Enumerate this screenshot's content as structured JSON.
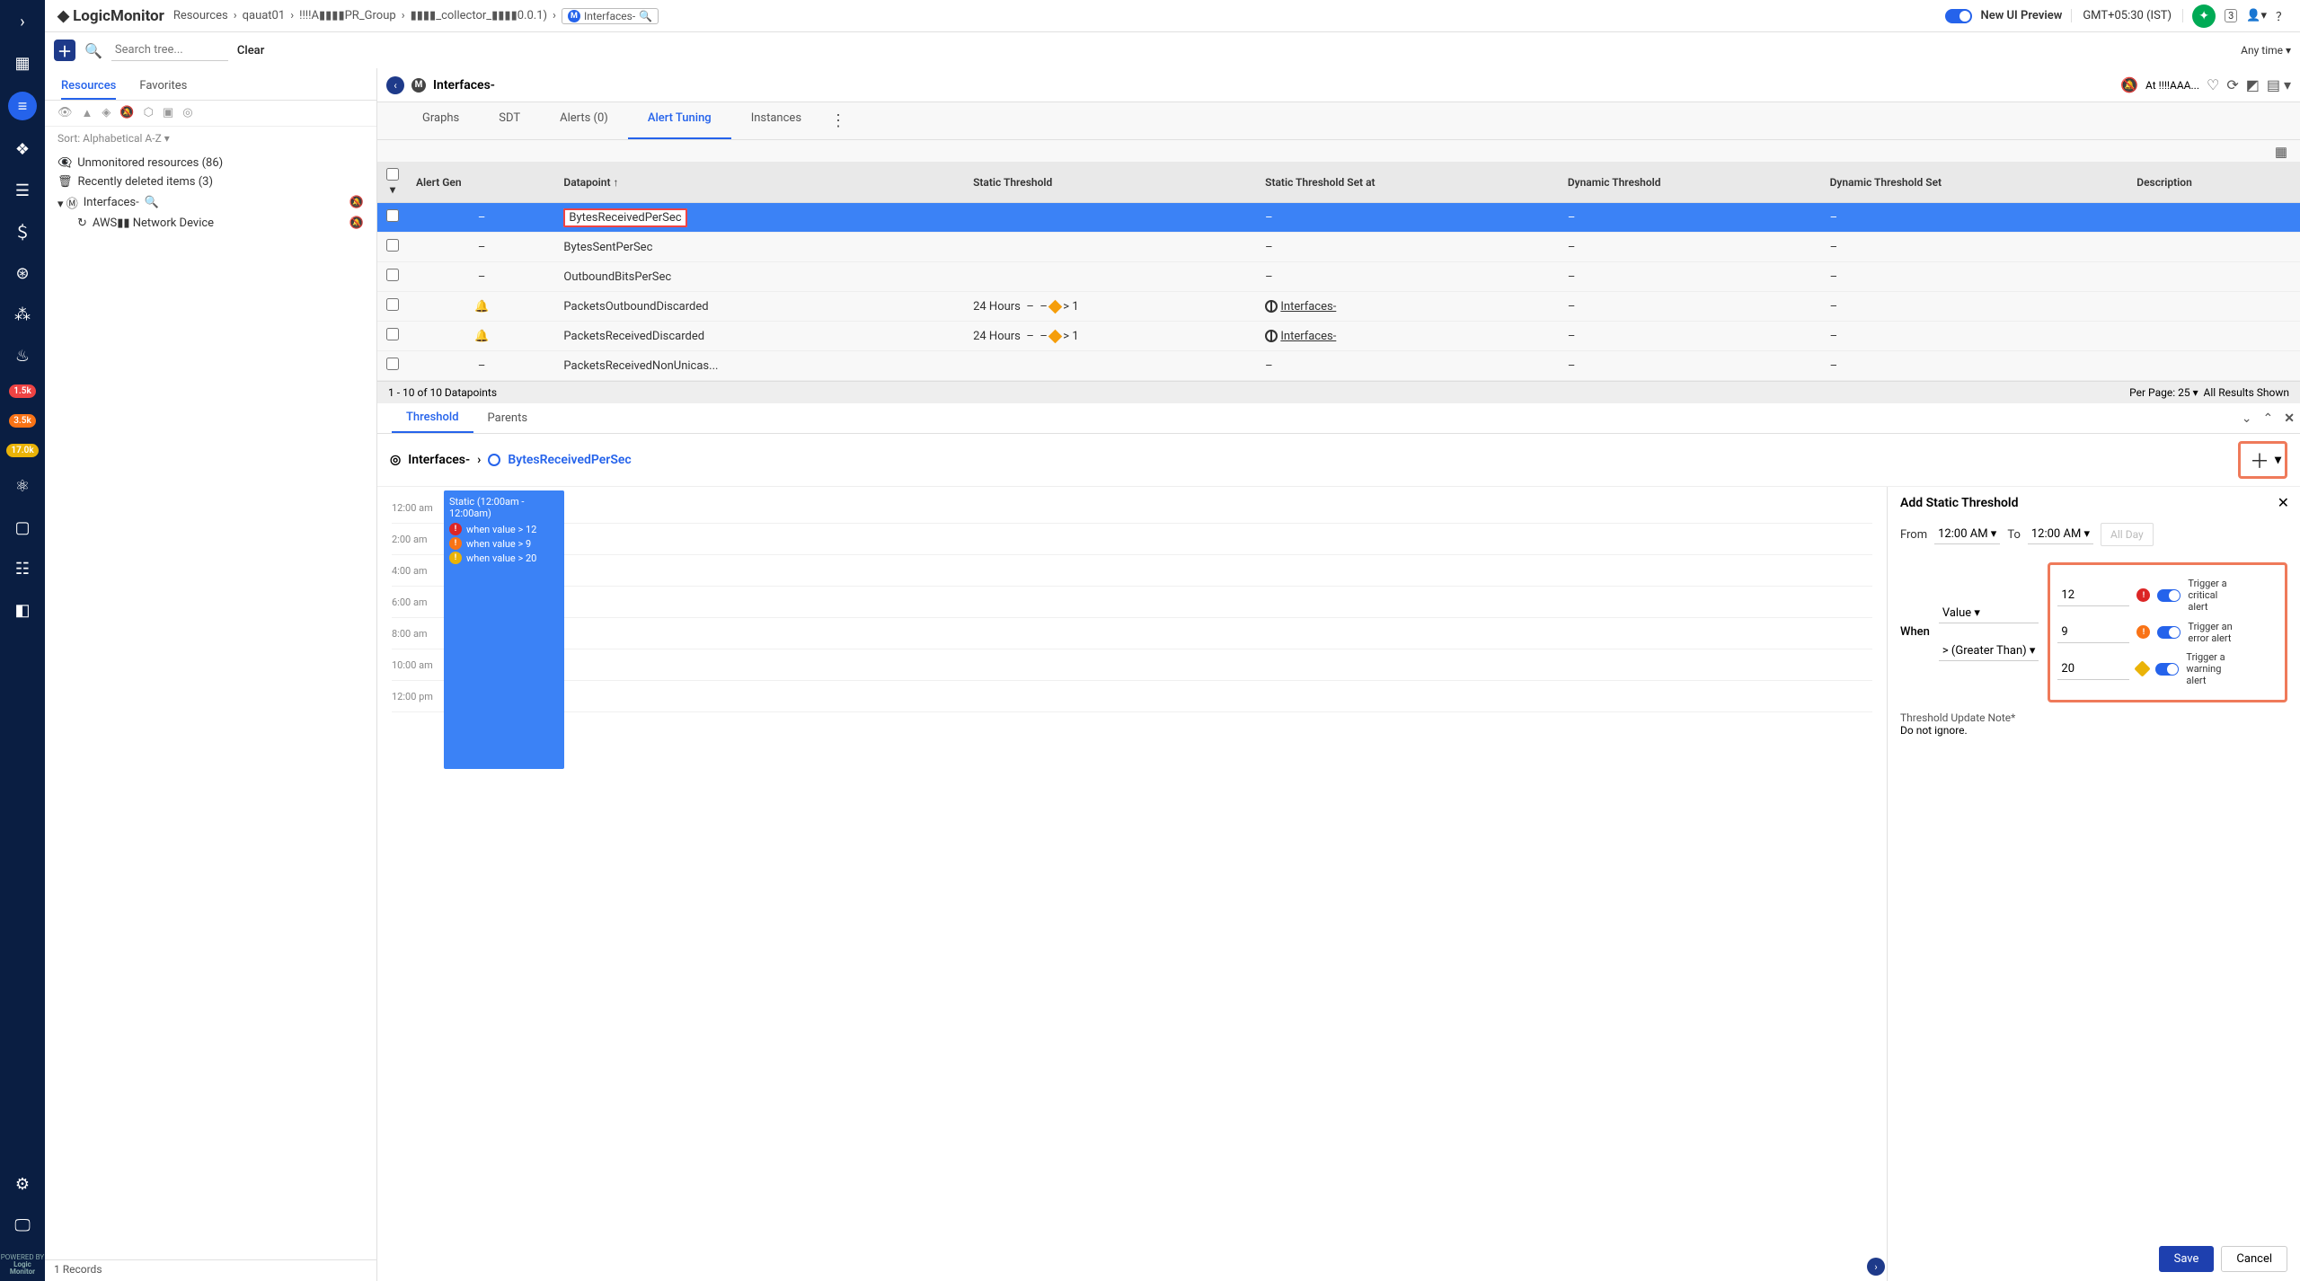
{
  "brand": "LogicMonitor",
  "breadcrumbs": {
    "root": "Resources",
    "a": "qauat01",
    "b": "!!!!A▮▮▮▮PR_Group",
    "c": "▮▮▮▮_collector_▮▮▮▮0.0.1)",
    "chip": "Interfaces-"
  },
  "topbar": {
    "preview": "New UI Preview",
    "tz": "GMT+05:30 (IST)",
    "msg": "3"
  },
  "toolbar": {
    "search_ph": "Search tree...",
    "clear": "Clear",
    "anytime": "Any time"
  },
  "tree": {
    "tabs": {
      "resources": "Resources",
      "favorites": "Favorites"
    },
    "sort_label": "Sort:",
    "sort_value": "Alphabetical A-Z",
    "unmon": "Unmonitored resources (86)",
    "recent": "Recently deleted items (3)",
    "node": "Interfaces-",
    "child": "AWS▮▮ Network Device"
  },
  "detail": {
    "title": "Interfaces-",
    "at": "At !!!!AAA...",
    "tabs": {
      "graphs": "Graphs",
      "sdt": "SDT",
      "alerts": "Alerts (0)",
      "tuning": "Alert Tuning",
      "instances": "Instances"
    }
  },
  "grid": {
    "cols": {
      "alertgen": "Alert Gen",
      "datapoint": "Datapoint",
      "static": "Static Threshold",
      "staticset": "Static Threshold Set at",
      "dynamic": "Dynamic Threshold",
      "dynset": "Dynamic Threshold Set",
      "desc": "Description"
    },
    "rows": [
      {
        "dp": "BytesReceivedPerSec",
        "sel": true
      },
      {
        "dp": "BytesSentPerSec"
      },
      {
        "dp": "OutboundBitsPerSec"
      },
      {
        "dp": "PacketsOutboundDiscarded",
        "st": "24 Hours",
        "gt": "> 1",
        "setat": "Interfaces-",
        "bell": true
      },
      {
        "dp": "PacketsReceivedDiscarded",
        "st": "24 Hours",
        "gt": "> 1",
        "setat": "Interfaces-",
        "bell": true
      },
      {
        "dp": "PacketsReceivedNonUnicas..."
      }
    ],
    "footer_left": "1 - 10 of 10 Datapoints",
    "perpage_lbl": "Per Page:",
    "perpage_val": "25",
    "allshown": "All Results Shown"
  },
  "lower": {
    "tabs": {
      "threshold": "Threshold",
      "parents": "Parents"
    },
    "crumb_a": "Interfaces-",
    "crumb_b": "BytesReceivedPerSec",
    "timeline": {
      "times": [
        "12:00 am",
        "2:00 am",
        "4:00 am",
        "6:00 am",
        "8:00 am",
        "10:00 am",
        "12:00 pm"
      ],
      "box_title": "Static (12:00am - 12:00am)",
      "rules": [
        {
          "t": "crit",
          "txt": "when value > 12"
        },
        {
          "t": "err",
          "txt": "when value > 9"
        },
        {
          "t": "warn",
          "txt": "when value > 20"
        }
      ]
    }
  },
  "form": {
    "title": "Add Static Threshold",
    "from": "From",
    "to": "To",
    "time": "12:00 AM",
    "allday": "All Day",
    "when": "When",
    "value": "Value",
    "op": "> (Greater Than)",
    "trig": [
      {
        "v": "12",
        "t": "crit",
        "lbl": "Trigger a critical alert"
      },
      {
        "v": "9",
        "t": "err",
        "lbl": "Trigger an error alert"
      },
      {
        "v": "20",
        "t": "warn",
        "lbl": "Trigger a warning alert"
      }
    ],
    "note_lbl": "Threshold Update Note*",
    "note_val": "Do not ignore.",
    "save": "Save",
    "cancel": "Cancel"
  },
  "footer": "1 Records",
  "navbadges": {
    "b1": "1.5k",
    "b2": "3.5k",
    "b3": "17.0k"
  }
}
